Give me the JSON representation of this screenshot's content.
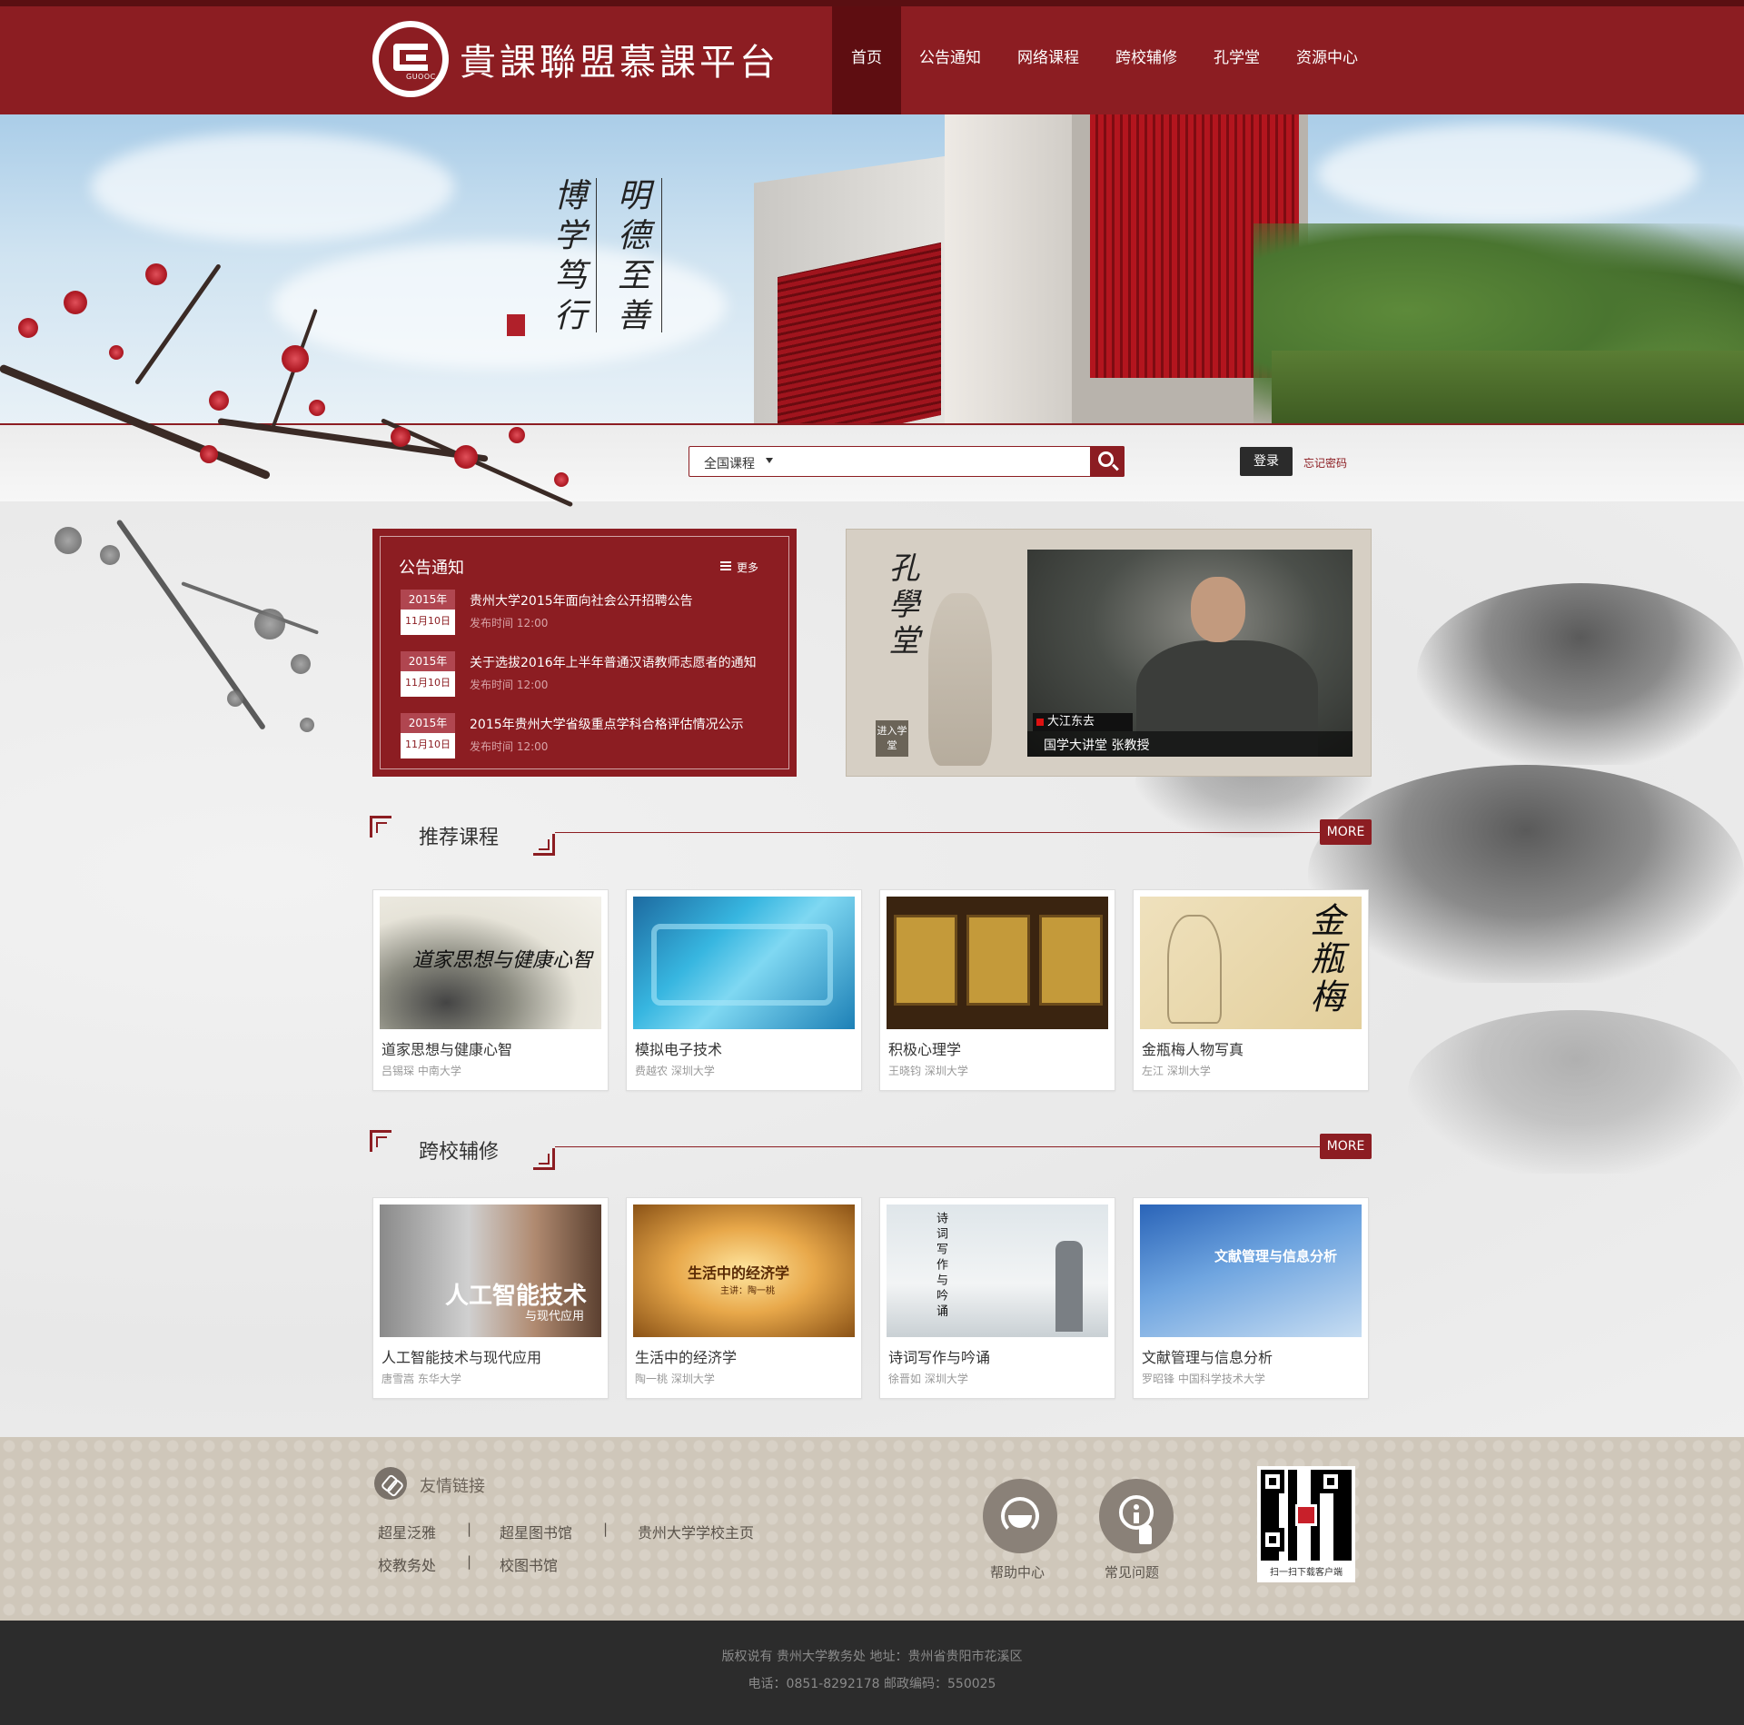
{
  "header": {
    "logo_text": "GUOOC",
    "site_title": "貴課聯盟慕課平台",
    "nav": [
      {
        "label": "首页",
        "active": true
      },
      {
        "label": "公告通知"
      },
      {
        "label": "网络课程"
      },
      {
        "label": "跨校辅修"
      },
      {
        "label": "孔学堂"
      },
      {
        "label": "资源中心"
      }
    ]
  },
  "banner": {
    "calligraphy_1": "明德至善",
    "calligraphy_2": "博学笃行"
  },
  "search": {
    "scope": "全国课程",
    "login_label": "登录",
    "forgot_label": "忘记密码"
  },
  "notice": {
    "title": "公告通知",
    "more_label": "更多",
    "items": [
      {
        "year": "2015年",
        "day": "11月10日",
        "text": "贵州大学2015年面向社会公开招聘公告",
        "time": "发布时间  12:00"
      },
      {
        "year": "2015年",
        "day": "11月10日",
        "text": "关于选拔2016年上半年普通汉语教师志愿者的通知",
        "time": "发布时间  12:00"
      },
      {
        "year": "2015年",
        "day": "11月10日",
        "text": "2015年贵州大学省级重点学科合格评估情况公示",
        "time": "发布时间  12:00"
      }
    ]
  },
  "kongxuetang": {
    "title": "孔學堂",
    "enter_label": "进入学堂",
    "video_tag": "大江东去",
    "caption": "国学大讲堂   张教授"
  },
  "recommended": {
    "title": "推荐课程",
    "more_label": "MORE",
    "courses": [
      {
        "title": "道家思想与健康心智",
        "meta": "吕锡琛   中南大学",
        "thumb_text": "道家思想与健康心智"
      },
      {
        "title": "模拟电子技术",
        "meta": "费越农   深圳大学",
        "thumb_text": ""
      },
      {
        "title": "积极心理学",
        "meta": "王晓钧   深圳大学",
        "thumb_text": ""
      },
      {
        "title": "金瓶梅人物写真",
        "meta": "左江   深圳大学",
        "thumb_text": "金瓶梅"
      }
    ]
  },
  "crossschool": {
    "title": "跨校辅修",
    "more_label": "MORE",
    "courses": [
      {
        "title": "人工智能技术与现代应用",
        "meta": "唐雪嵩   东华大学",
        "thumb_text": "人工智能技术",
        "thumb_sub": "与现代应用"
      },
      {
        "title": "生活中的经济学",
        "meta": "陶一桃   深圳大学",
        "thumb_text": "生活中的经济学",
        "thumb_sub": "主讲：陶一桃"
      },
      {
        "title": "诗词写作与吟诵",
        "meta": "徐晋如   深圳大学",
        "thumb_text": "诗词写作与吟诵",
        "thumb_sub": ""
      },
      {
        "title": "文献管理与信息分析",
        "meta": "罗昭锋   中国科学技术大学",
        "thumb_text": "文献管理与信息分析",
        "thumb_sub": ""
      }
    ]
  },
  "footer": {
    "links_title": "友情链接",
    "links_row1": [
      "超星泛雅",
      "超星图书馆",
      "贵州大学学校主页"
    ],
    "links_row2": [
      "校教务处",
      "校图书馆"
    ],
    "separator": "|",
    "help_label": "帮助中心",
    "faq_label": "常见问题",
    "qr_label": "扫一扫下载客户端",
    "copyright": "版权说有 贵州大学教务处    地址：贵州省贵阳市花溪区",
    "contact": "电话：0851-8292178    邮政编码：550025"
  },
  "colors": {
    "brand_red": "#8c1d22",
    "dark_red": "#5e0d11",
    "footer_bg": "#cfc7ba",
    "bottom_bg": "#2c2c2c"
  }
}
